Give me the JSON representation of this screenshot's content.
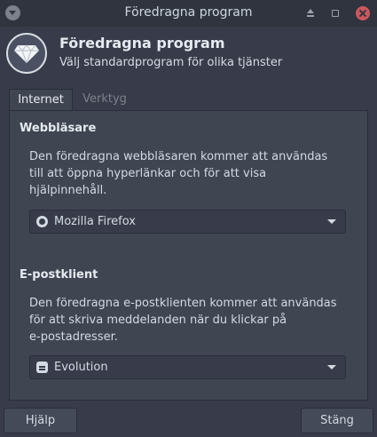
{
  "window": {
    "title": "Föredragna program"
  },
  "header": {
    "title": "Föredragna program",
    "subtitle": "Välj standardprogram för olika tjänster",
    "icon": "diamond-icon"
  },
  "tabs": [
    {
      "label": "Internet",
      "active": true
    },
    {
      "label": "Verktyg",
      "active": false
    }
  ],
  "sections": {
    "browser": {
      "title": "Webbläsare",
      "description": "Den föredragna webbläsaren kommer att användas\ntill att öppna hyperlänkar och för att visa\nhjälpinnehåll.",
      "selected": "Mozilla Firefox",
      "icon": "firefox-icon"
    },
    "mail": {
      "title": "E-postklient",
      "description": "Den föredragna e-postklienten kommer att användas\nför att skriva meddelanden när du klickar på\ne-postadresser.",
      "selected": "Evolution",
      "icon": "evolution-icon"
    }
  },
  "buttons": {
    "help": "Hjälp",
    "close": "Stäng"
  },
  "colors": {
    "background": "#383c4a",
    "titlebar": "#2f343f",
    "panel": "#404552",
    "close_button": "#cc575d"
  }
}
